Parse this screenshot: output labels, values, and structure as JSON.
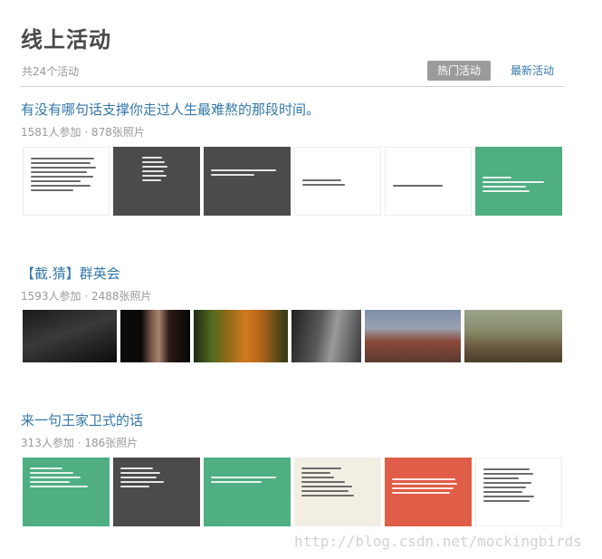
{
  "header": {
    "title": "线上活动",
    "count_text": "共24个活动",
    "tab_hot": "热门活动",
    "tab_new": "最新活动"
  },
  "activities": [
    {
      "title": "有没有哪句话支撑你走过人生最难熬的那段时间。",
      "stats": "1581人参加 · 878张照片"
    },
    {
      "title": "【截.猜】群英会",
      "stats": "1593人参加 · 2488张照片"
    },
    {
      "title": "来一句王家卫式的话",
      "stats": "313人参加 · 186张照片"
    }
  ],
  "thumb_colors": {
    "white": "#ffffff",
    "dark": "#4b4b4b",
    "green": "#4fae82",
    "cream": "#f3eee3",
    "red": "#e05d48",
    "link": "#3377aa"
  },
  "watermark": "http://blog.csdn.net/mockingbirds"
}
